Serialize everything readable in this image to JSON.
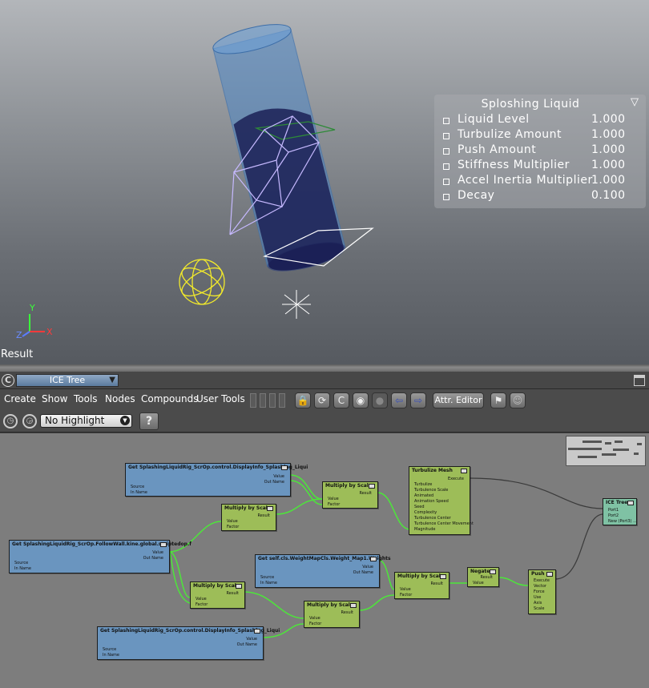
{
  "viewport": {
    "result_label": "Result",
    "axis": {
      "x": "X",
      "y": "Y",
      "z": "Z"
    }
  },
  "ppg": {
    "title": "Sploshing Liquid",
    "rows": [
      {
        "label": "Liquid Level",
        "value": "1.000"
      },
      {
        "label": "Turbulize Amount",
        "value": "1.000"
      },
      {
        "label": "Push Amount",
        "value": "1.000"
      },
      {
        "label": "Stiffness Multiplier",
        "value": "1.000"
      },
      {
        "label": "Accel Inertia Multiplier",
        "value": "1.000"
      },
      {
        "label": "Decay",
        "value": "0.100"
      }
    ]
  },
  "ice_header": {
    "tree_name": "ICE Tree"
  },
  "menubar": {
    "items": [
      "Create",
      "Show",
      "Tools",
      "Nodes",
      "Compounds",
      "User Tools"
    ],
    "attr_editor": "Attr. Editor"
  },
  "toolbar2": {
    "highlight_selected": "No Highlight",
    "help": "?"
  },
  "nodes": {
    "get_display_info_top": {
      "title": "Get SplashingLiquidRig_ScrOp.control.DisplayInfo_Splashing_Liqui",
      "ports_in": [
        "Source",
        "In Name"
      ],
      "ports_out": [
        "Value",
        "Out Name"
      ]
    },
    "get_followwall": {
      "title": "Get SplashingLiquidRig_ScrOp.FollowWall.kine.global.scriptedop.f",
      "ports_in": [
        "Source",
        "In Name"
      ],
      "ports_out": [
        "Value",
        "Out Name"
      ]
    },
    "get_weightmap": {
      "title": "Get self.cls.WeightMapCls.Weight_Map1.Weights",
      "ports_in": [
        "Source",
        "In Name"
      ],
      "ports_out": [
        "Value",
        "Out Name"
      ]
    },
    "get_display_info_bottom": {
      "title": "Get SplashingLiquidRig_ScrOp.control.DisplayInfo_Splashing_Liqui",
      "ports_in": [
        "Source",
        "In Name"
      ],
      "ports_out": [
        "Value",
        "Out Name"
      ]
    },
    "mult1": {
      "title": "Multiply by Scalar",
      "ports_in": [
        "Value",
        "Factor"
      ],
      "ports_out": [
        "Result"
      ]
    },
    "mult2": {
      "title": "Multiply by Scalar",
      "ports_in": [
        "Value",
        "Factor"
      ],
      "ports_out": [
        "Result"
      ]
    },
    "mult3": {
      "title": "Multiply by Scalar",
      "ports_in": [
        "Value",
        "Factor"
      ],
      "ports_out": [
        "Result"
      ]
    },
    "mult4": {
      "title": "Multiply by Scalar",
      "ports_in": [
        "Value",
        "Factor"
      ],
      "ports_out": [
        "Result"
      ]
    },
    "mult5": {
      "title": "Multiply by Scalar",
      "ports_in": [
        "Value",
        "Factor"
      ],
      "ports_out": [
        "Result"
      ]
    },
    "turbulize": {
      "title": "Turbulize Mesh",
      "ports_in": [
        "Turbulize",
        "Turbulence Scale",
        "Animated",
        "Animation Speed",
        "Seed",
        "Complexity",
        "Turbulence Center",
        "Turbulence Center Movement",
        "Magnitude"
      ],
      "ports_out": [
        "Execute"
      ]
    },
    "negate": {
      "title": "Negate",
      "ports_in": [
        "Value"
      ],
      "ports_out": [
        "Result"
      ]
    },
    "push": {
      "title": "Push",
      "ports_in": [
        "Vector",
        "Force",
        "Use",
        "Axis",
        "Scale"
      ],
      "ports_out": [
        "Execute"
      ]
    },
    "ice_tree": {
      "title": "ICE Tree",
      "ports_in": [
        "Port1",
        "Port2",
        "New (Port3) ..."
      ],
      "ports_out": []
    }
  }
}
